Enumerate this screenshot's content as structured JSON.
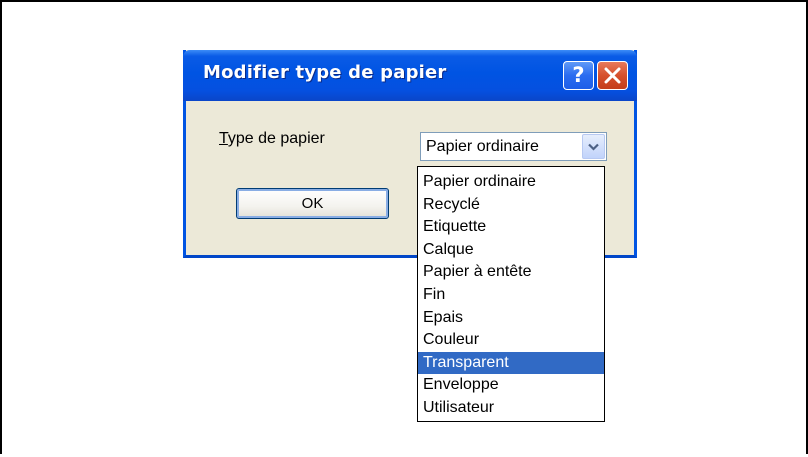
{
  "dialog": {
    "title": "Modifier type de papier",
    "help_label": "?",
    "close_icon": "close-icon",
    "paper_type_label_accel": "T",
    "paper_type_label_rest": "ype de papier",
    "ok_label": "OK"
  },
  "select": {
    "value": "Papier ordinaire",
    "arrow_icon": "chevron-down-icon"
  },
  "dropdown": {
    "options": [
      "Papier ordinaire",
      "Recyclé",
      "Etiquette",
      "Calque",
      "Papier à entête",
      "Fin",
      "Epais",
      "Couleur",
      "Transparent",
      "Enveloppe",
      "Utilisateur"
    ],
    "highlighted": "Transparent"
  },
  "colors": {
    "title_bar": "#0054e3",
    "highlight": "#316ac5",
    "dialog_bg": "#ece9d8",
    "close_button": "#d6502c"
  }
}
